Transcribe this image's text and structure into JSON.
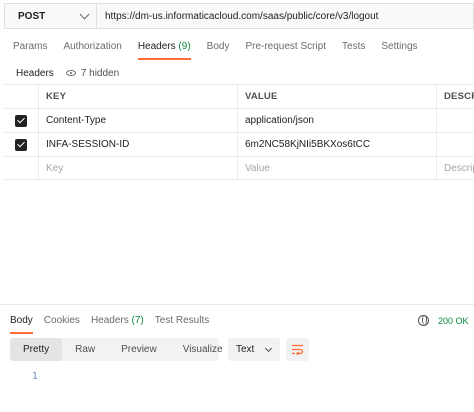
{
  "request": {
    "method": "POST",
    "url": "https://dm-us.informaticacloud.com/saas/public/core/v3/logout"
  },
  "request_tabs": [
    {
      "label": "Params",
      "count": ""
    },
    {
      "label": "Authorization",
      "count": ""
    },
    {
      "label": "Headers",
      "count": "(9)"
    },
    {
      "label": "Body",
      "count": ""
    },
    {
      "label": "Pre-request Script",
      "count": ""
    },
    {
      "label": "Tests",
      "count": ""
    },
    {
      "label": "Settings",
      "count": ""
    }
  ],
  "headers_section": {
    "label": "Headers",
    "hidden_text": "7 hidden"
  },
  "table": {
    "columns": {
      "key": "KEY",
      "value": "VALUE",
      "description": "DESCRI"
    },
    "rows": [
      {
        "key": "Content-Type",
        "value": "application/json",
        "description": "",
        "checked": true
      },
      {
        "key": "INFA-SESSION-ID",
        "value": "6m2NC58KjNIi5BKXos6tCC",
        "description": "",
        "checked": true
      }
    ],
    "placeholder": {
      "key": "Key",
      "value": "Value",
      "description": "Descrip"
    }
  },
  "response_tabs": [
    {
      "label": "Body",
      "count": ""
    },
    {
      "label": "Cookies",
      "count": ""
    },
    {
      "label": "Headers",
      "count": "(7)"
    },
    {
      "label": "Test Results",
      "count": ""
    }
  ],
  "response": {
    "status": "200 OK",
    "formats": [
      "Pretty",
      "Raw",
      "Preview",
      "Visualize"
    ],
    "language": "Text",
    "line_numbers": [
      "1"
    ]
  },
  "colors": {
    "accent": "#ff6c37",
    "success": "#0b8a3e"
  }
}
